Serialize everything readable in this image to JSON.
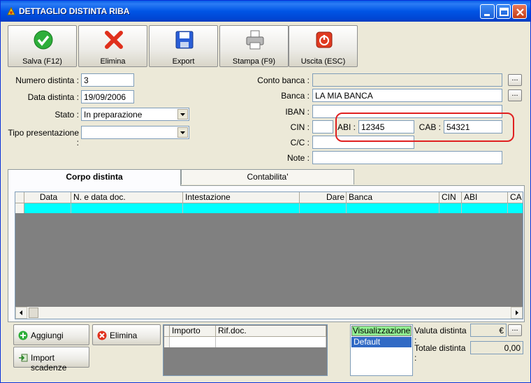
{
  "window": {
    "title": "DETTAGLIO DISTINTA RIBA"
  },
  "toolbar": {
    "buttons": [
      {
        "label": "Salva (F12)",
        "icon": "check-icon"
      },
      {
        "label": "Elimina",
        "icon": "delete-x-icon"
      },
      {
        "label": "Export",
        "icon": "floppy-disk-icon"
      },
      {
        "label": "Stampa (F9)",
        "icon": "printer-icon"
      },
      {
        "label": "Uscita (ESC)",
        "icon": "exit-icon"
      }
    ]
  },
  "form": {
    "numero_distinta_label": "Numero distinta :",
    "numero_distinta": "3",
    "data_distinta_label": "Data distinta :",
    "data_distinta": "19/09/2006",
    "stato_label": "Stato :",
    "stato": "In preparazione",
    "tipo_presentazione_label": "Tipo presentazione :",
    "tipo_presentazione": "",
    "conto_banca_label": "Conto banca :",
    "conto_banca": "",
    "banca_label": "Banca :",
    "banca": "LA MIA BANCA",
    "iban_label": "IBAN :",
    "iban": "",
    "cin_label": "CIN :",
    "cin": "",
    "abi_label": "ABI :",
    "abi": "12345",
    "cab_label": "CAB :",
    "cab": "54321",
    "cc_label": "C/C :",
    "cc": "",
    "note_label": "Note :",
    "note": "",
    "ellipsis": "..."
  },
  "tabs": [
    {
      "label": "Corpo distinta",
      "active": true
    },
    {
      "label": "Contabilita'",
      "active": false
    }
  ],
  "grid": {
    "columns": [
      "Data",
      "N. e data doc.",
      "Intestazione",
      "Dare",
      "Banca",
      "CIN",
      "ABI",
      "CA"
    ]
  },
  "bottom": {
    "aggiungi_label": "Aggiungi",
    "elimina_label": "Elimina",
    "import_label": "Import scadenze",
    "mini_columns": [
      "Importo",
      "Rif.doc."
    ],
    "visualizzazione_header": "Visualizzazione",
    "visualizzazione_selected": "Default",
    "valuta_label": "Valuta distinta :",
    "valuta_value": "€",
    "totale_label": "Totale distinta :",
    "totale_value": "0,00"
  },
  "colors": {
    "titlebar": "#0055e5",
    "grid_row_highlight": "#00ffff",
    "annotation_red": "#e02020",
    "vis_header": "#90ee90",
    "selection": "#316ac5"
  }
}
